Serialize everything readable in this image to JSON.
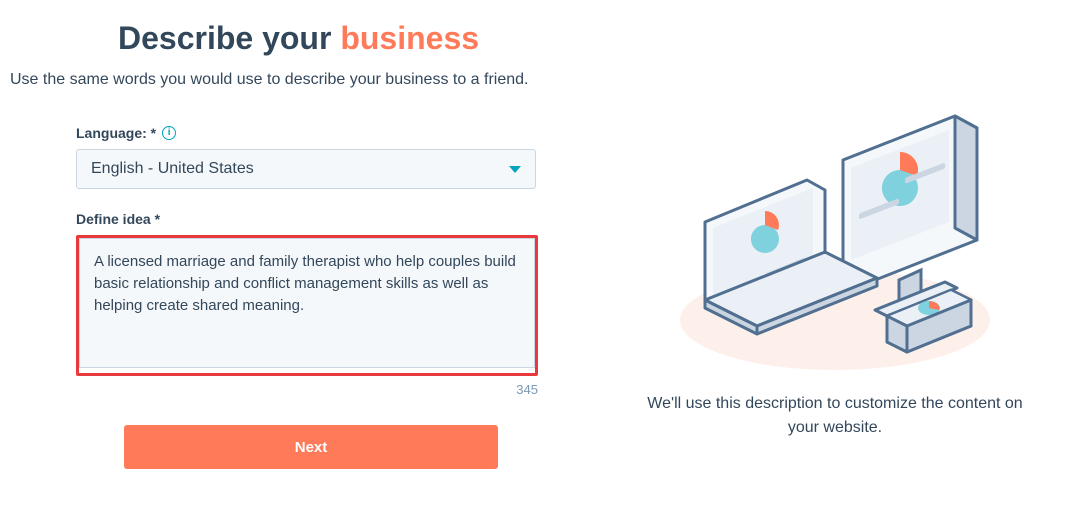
{
  "header": {
    "title_plain": "Describe your ",
    "title_highlight": "business",
    "subtitle": "Use the same words you would use to describe your business to a friend."
  },
  "form": {
    "language_label": "Language: *",
    "language_value": "English - United States",
    "idea_label": "Define idea *",
    "idea_value": "A licensed marriage and family therapist who help couples build basic relationship and conflict management skills as well as helping create shared meaning.",
    "char_counter": "345",
    "next_label": "Next"
  },
  "right": {
    "caption": "We'll use this description to customize the content on your website."
  },
  "colors": {
    "accent": "#ff7a59",
    "teal": "#00a4bd",
    "highlight_border": "#e8393c"
  }
}
